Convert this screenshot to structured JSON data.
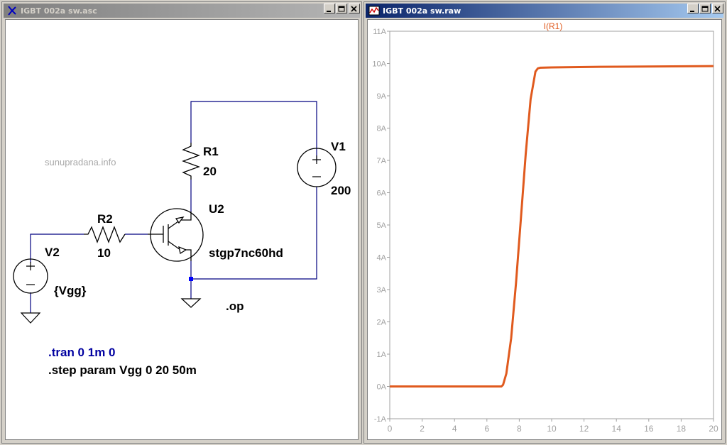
{
  "schematic_window": {
    "title": "IGBT 002a sw.asc",
    "watermark": "sunupradana.info",
    "components": {
      "r1_name": "R1",
      "r1_value": "20",
      "r2_name": "R2",
      "r2_value": "10",
      "v1_name": "V1",
      "v1_value": "200",
      "v2_name": "V2",
      "v2_value": "{Vgg}",
      "u2_name": "U2",
      "u2_model": "stgp7nc60hd"
    },
    "directives": {
      "op": ".op",
      "tran": ".tran 0 1m 0",
      "step": ".step param Vgg 0 20 50m"
    },
    "colors": {
      "wire": "#000080",
      "component": "#000000",
      "directive_blue": "#0000a0",
      "junction": "#0000ff"
    }
  },
  "waveform_window": {
    "title": "IGBT 002a sw.raw",
    "trace_label": "I(R1)",
    "colors": {
      "trace": "#e05a1e",
      "axis_text": "#a0a0a0",
      "frame": "#a0a0a0"
    }
  },
  "chart_data": {
    "type": "line",
    "title": "I(R1)",
    "xlabel": "",
    "ylabel": "",
    "xlim": [
      0,
      20
    ],
    "ylim": [
      -1,
      11
    ],
    "x_ticks": [
      "0",
      "2",
      "4",
      "6",
      "8",
      "10",
      "12",
      "14",
      "16",
      "18",
      "20"
    ],
    "y_ticks": [
      "-1A",
      "0A",
      "1A",
      "2A",
      "3A",
      "4A",
      "5A",
      "6A",
      "7A",
      "8A",
      "9A",
      "10A",
      "11A"
    ],
    "grid": false,
    "series": [
      {
        "name": "I(R1)",
        "x": [
          0,
          6.9,
          7.0,
          7.2,
          7.5,
          7.8,
          8.1,
          8.4,
          8.7,
          9.0,
          9.15,
          9.3,
          10,
          13,
          20
        ],
        "y": [
          0,
          0,
          0.05,
          0.4,
          1.5,
          3.2,
          5.2,
          7.2,
          8.9,
          9.75,
          9.85,
          9.87,
          9.88,
          9.9,
          9.92
        ]
      }
    ]
  }
}
